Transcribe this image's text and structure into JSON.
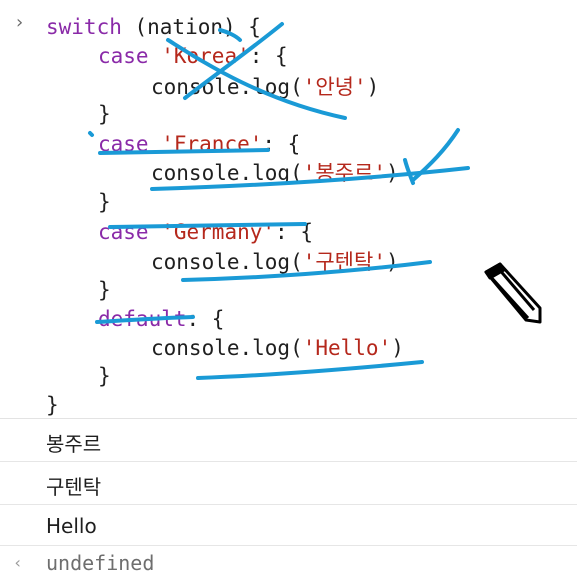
{
  "code": {
    "line1": {
      "kw": "switch",
      "rest": " (nation) {"
    },
    "line2": {
      "kw": "case",
      "str": "'Korea'",
      "rest": ": {"
    },
    "line3": {
      "pre": "console.log(",
      "str": "'안녕'",
      "post": ")"
    },
    "line4": "}",
    "line5": {
      "kw": "case",
      "str": "'France'",
      "rest": ": {"
    },
    "line6": {
      "pre": "console.log(",
      "str": "'봉주르'",
      "post": ")"
    },
    "line7": "}",
    "line8": {
      "kw": "case",
      "str": "'Germany'",
      "rest": ": {"
    },
    "line9": {
      "pre": "console.log(",
      "str": "'구텐탁'",
      "post": ")"
    },
    "line10": "}",
    "line11": {
      "kw": "default",
      "rest": ": {"
    },
    "line12": {
      "pre": "console.log(",
      "str": "'Hello'",
      "post": ")"
    },
    "line13": "}",
    "line14": "}"
  },
  "outputs": [
    "봉주르",
    "구텐탁",
    "Hello"
  ],
  "result": "undefined",
  "icons": {
    "prompt": "chevron-right-icon",
    "result": "chevron-left-icon",
    "cursor": "pencil-icon"
  },
  "colors": {
    "keyword": "#8a2aa8",
    "string": "#b5281c",
    "annotation": "#1a9ad6"
  }
}
